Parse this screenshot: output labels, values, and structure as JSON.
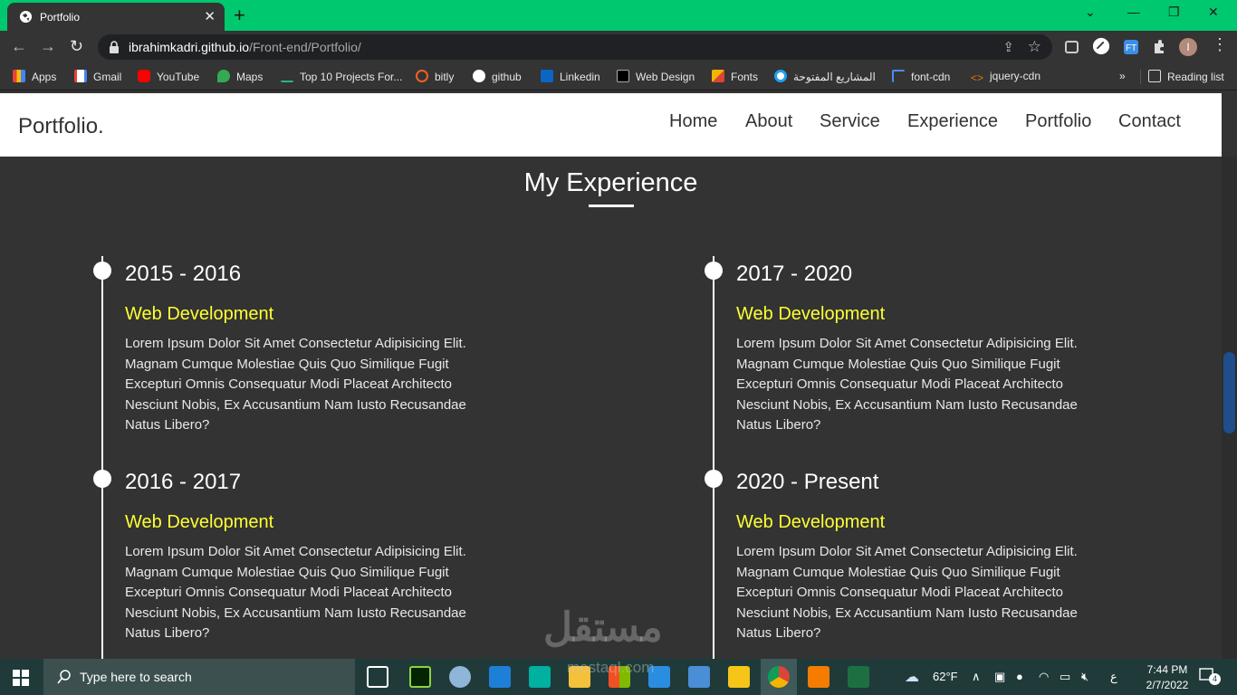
{
  "browser": {
    "tab_title": "Portfolio",
    "tab_close": "✕",
    "new_tab": "+",
    "url_host": "ibrahimkadri.github.io",
    "url_path": "/Front-end/Portfolio/",
    "bookmarks": [
      "Apps",
      "Gmail",
      "YouTube",
      "Maps",
      "Top 10 Projects For...",
      "bitly",
      "github",
      "Linkedin",
      "Web Design",
      "Fonts",
      "المشاريع المفتوحة",
      "font-cdn",
      "jquery-cdn"
    ],
    "more": "»",
    "reading_list": "Reading list",
    "profile_initial": "I"
  },
  "page": {
    "logo": "Portfolio.",
    "nav": [
      "Home",
      "About",
      "Service",
      "Experience",
      "Portfolio",
      "Contact"
    ],
    "section_title": "My Experience",
    "entries": [
      {
        "date": "2015 - 2016",
        "role": "Web Development",
        "desc": "Lorem Ipsum Dolor Sit Amet Consectetur Adipisicing Elit. Magnam Cumque Molestiae Quis Quo Similique Fugit Excepturi Omnis Consequatur Modi Placeat Architecto Nesciunt Nobis, Ex Accusantium Nam Iusto Recusandae Natus Libero?"
      },
      {
        "date": "2017 - 2020",
        "role": "Web Development",
        "desc": "Lorem Ipsum Dolor Sit Amet Consectetur Adipisicing Elit. Magnam Cumque Molestiae Quis Quo Similique Fugit Excepturi Omnis Consequatur Modi Placeat Architecto Nesciunt Nobis, Ex Accusantium Nam Iusto Recusandae Natus Libero?"
      },
      {
        "date": "2016 - 2017",
        "role": "Web Development",
        "desc": "Lorem Ipsum Dolor Sit Amet Consectetur Adipisicing Elit. Magnam Cumque Molestiae Quis Quo Similique Fugit Excepturi Omnis Consequatur Modi Placeat Architecto Nesciunt Nobis, Ex Accusantium Nam Iusto Recusandae Natus Libero?"
      },
      {
        "date": "2020 - Present",
        "role": "Web Development",
        "desc": "Lorem Ipsum Dolor Sit Amet Consectetur Adipisicing Elit. Magnam Cumque Molestiae Quis Quo Similique Fugit Excepturi Omnis Consequatur Modi Placeat Architecto Nesciunt Nobis, Ex Accusantium Nam Iusto Recusandae Natus Libero?"
      }
    ]
  },
  "watermark": {
    "arabic": "مستقل",
    "latin": "mostaql.com"
  },
  "taskbar": {
    "search_placeholder": "Type here to search",
    "weather": "62°F",
    "lang": "ع",
    "time": "7:44 PM",
    "date": "2/7/2022",
    "notifications": "4"
  },
  "colors": {
    "tab_strip": "#00c86e",
    "chrome_dark": "#343434",
    "page_bg": "#333333",
    "accent_yellow": "#ffff33",
    "taskbar": "#203a3a"
  }
}
